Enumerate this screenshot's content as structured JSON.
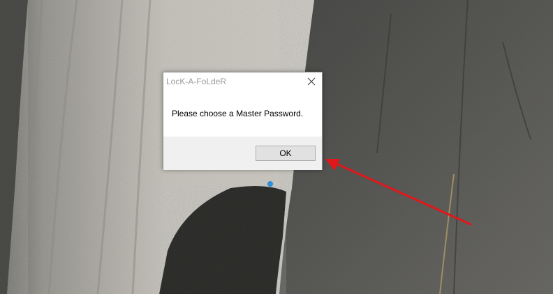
{
  "dialog": {
    "title": "LocK-A-FoLdeR",
    "message": "Please choose a Master Password.",
    "ok_label": "OK",
    "close_icon": "close-icon"
  },
  "annotation": {
    "arrow_color": "#e0181b"
  },
  "colors": {
    "dialog_bg": "#ffffff",
    "footer_bg": "#f0f0f0",
    "button_bg": "#e1e1e1",
    "title_text": "#9a9a9a"
  }
}
